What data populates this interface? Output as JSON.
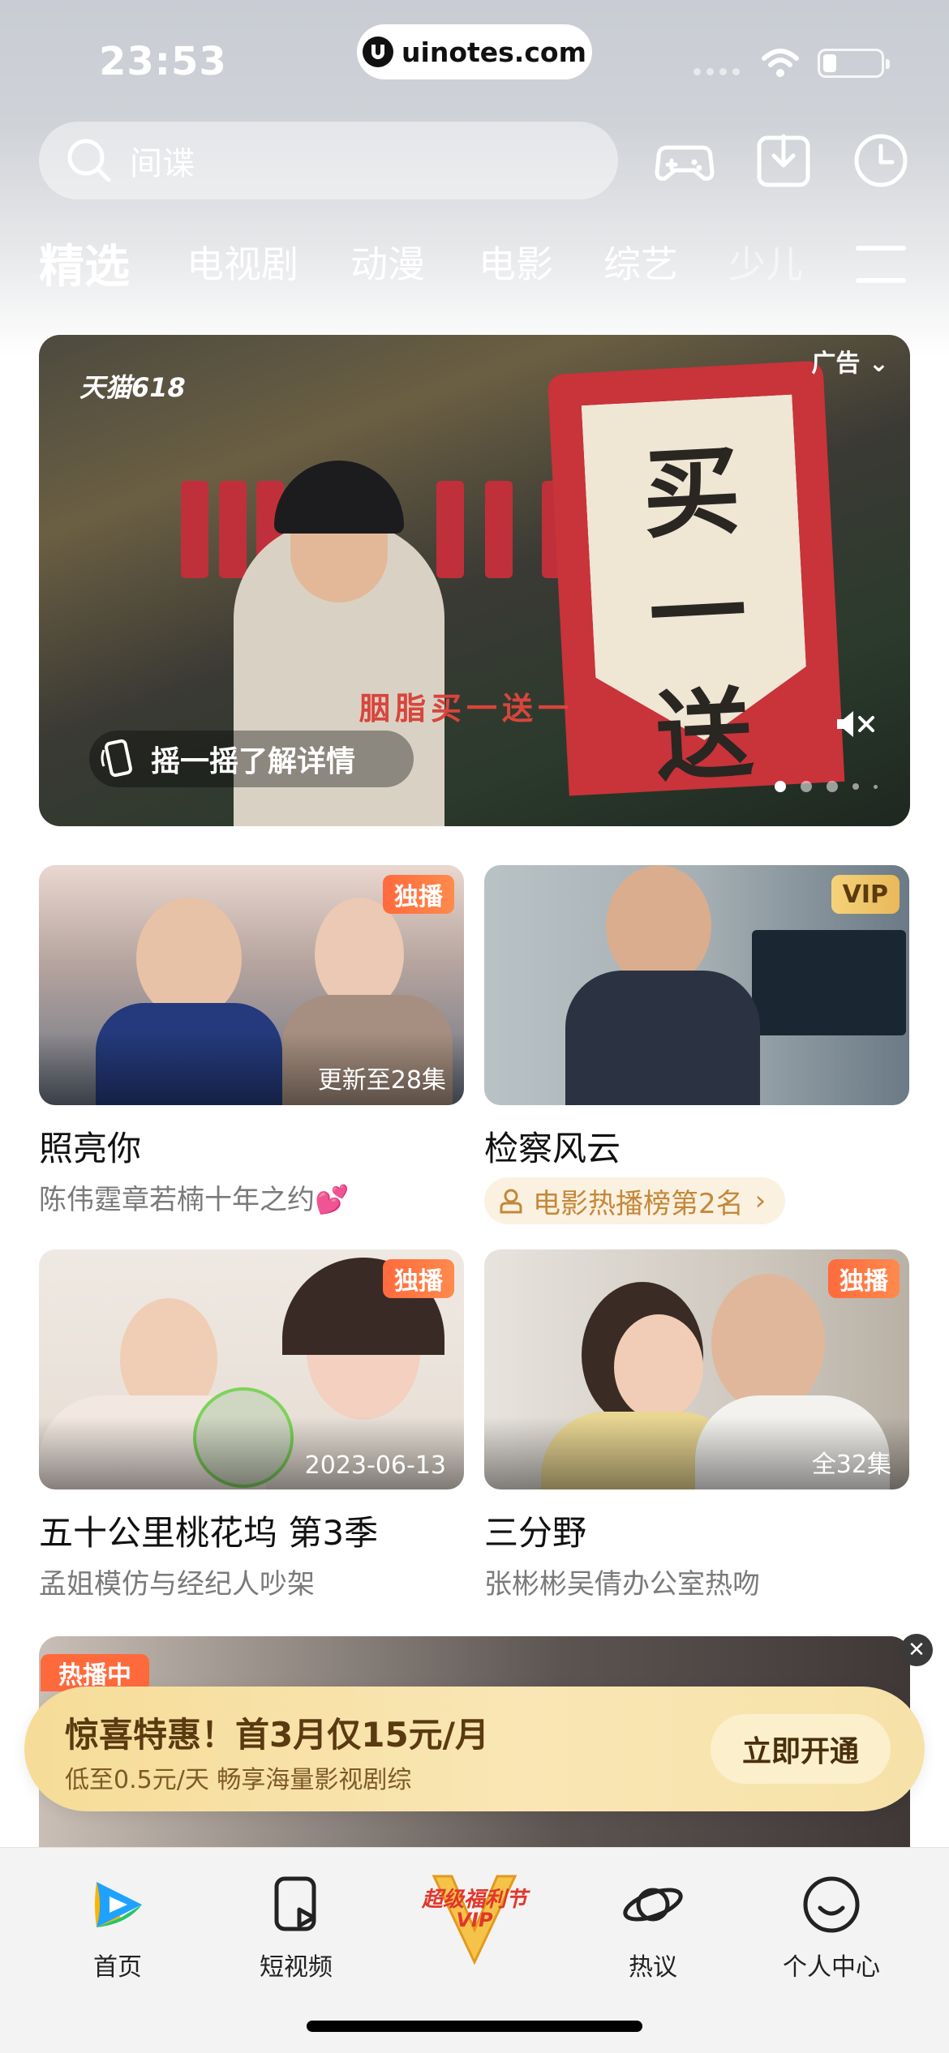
{
  "status_bar": {
    "time": "23:53",
    "url": "uinotes.com"
  },
  "search": {
    "placeholder": "间谍",
    "icons": [
      "search-icon",
      "gamepad-icon",
      "download-icon",
      "history-clock-icon"
    ]
  },
  "tabs": [
    {
      "label": "精选",
      "active": true
    },
    {
      "label": "电视剧"
    },
    {
      "label": "动漫"
    },
    {
      "label": "电影"
    },
    {
      "label": "综艺"
    },
    {
      "label": "少儿"
    }
  ],
  "banner": {
    "ad_label": "广告",
    "brand": "天猫618",
    "sign_text": "买一送一",
    "caption": "胭脂买一送一",
    "shake_text": "摇一摇了解详情"
  },
  "cards": [
    {
      "title": "照亮你",
      "subtitle": "陈伟霆章若楠十年之约💕",
      "badge": "独播",
      "corner": "更新至28集"
    },
    {
      "title": "检察风云",
      "rank_label": "电影热播榜第2名",
      "badge": "VIP"
    },
    {
      "title": "五十公里桃花坞 第3季",
      "subtitle": "孟姐模仿与经纪人吵架",
      "badge": "独播",
      "corner": "2023-06-13"
    },
    {
      "title": "三分野",
      "subtitle": "张彬彬吴倩办公室热吻",
      "badge": "独播",
      "corner": "全32集"
    }
  ],
  "promo": {
    "hot_tag": "热播中",
    "headline": "惊喜特惠！首3月仅15元/月",
    "subline": "低至0.5元/天 畅享海量影视剧综",
    "button": "立即开通"
  },
  "tab_bar": {
    "items": [
      {
        "label": "首页",
        "icon": "home-play-icon"
      },
      {
        "label": "短视频",
        "icon": "short-video-icon"
      },
      {
        "label": "超级福利节",
        "sub": "VIP",
        "icon": "vip-festival-icon"
      },
      {
        "label": "热议",
        "icon": "planet-icon"
      },
      {
        "label": "个人中心",
        "icon": "profile-smile-icon"
      }
    ]
  },
  "colors": {
    "excl_badge": "#ff6a3d",
    "vip_gold": "#f5d27a",
    "rank_text": "#c4883a"
  }
}
